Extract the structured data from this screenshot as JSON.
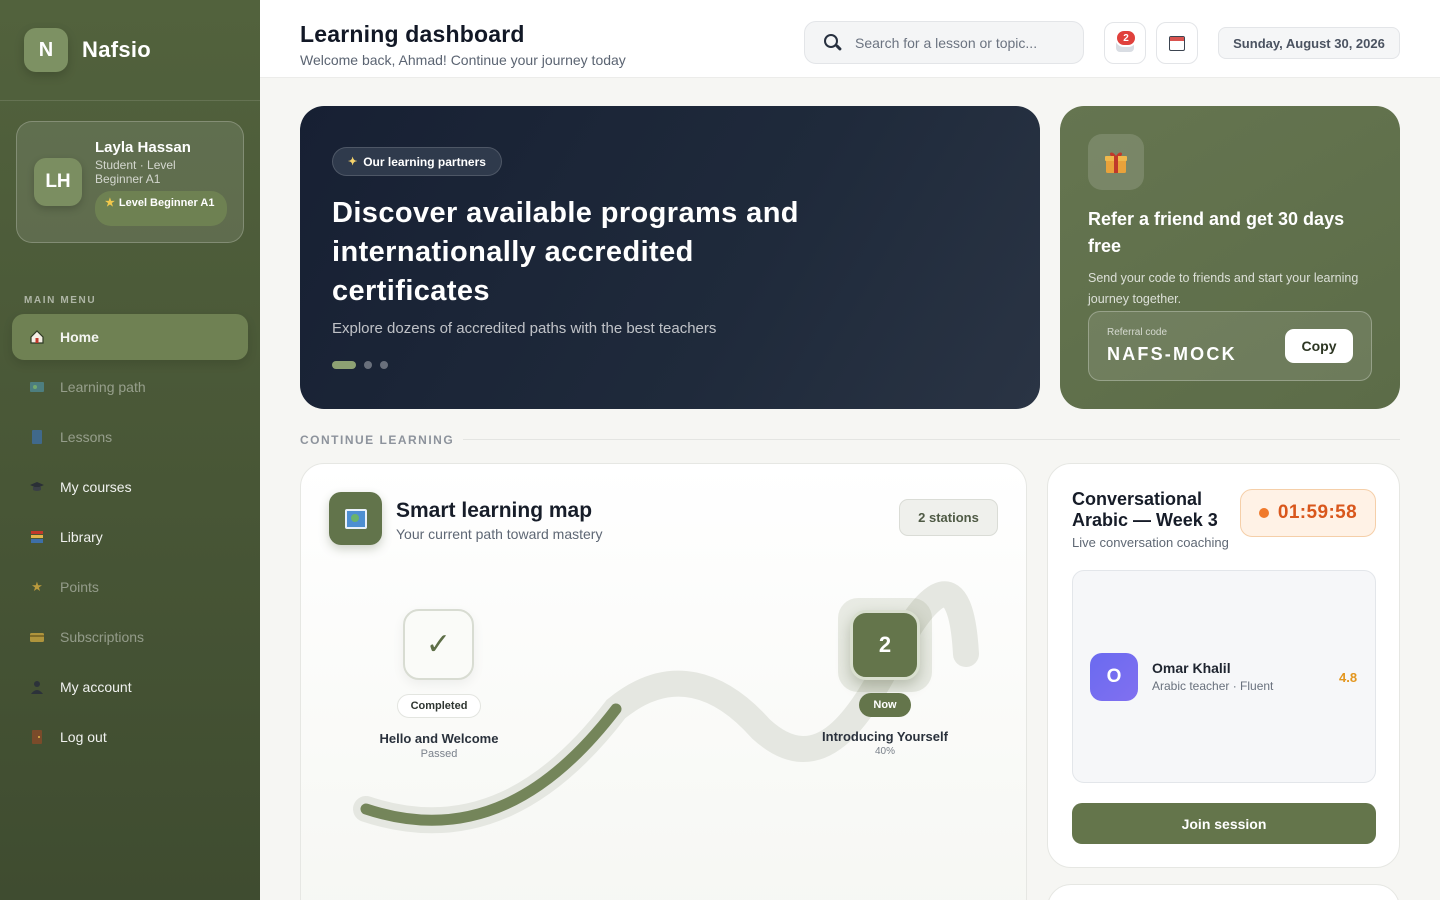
{
  "brand": {
    "logo_letter": "N",
    "name": "Nafsio"
  },
  "profile": {
    "initials": "LH",
    "name": "Layla Hassan",
    "role": "Student · Level Beginner A1",
    "level_badge": "Level Beginner A1"
  },
  "sidebar": {
    "caption": "MAIN MENU",
    "items": [
      {
        "label": "Home",
        "icon": "home-icon",
        "active": true
      },
      {
        "label": "Learning path",
        "icon": "map-icon",
        "active": false
      },
      {
        "label": "Lessons",
        "icon": "book-icon",
        "active": false
      },
      {
        "label": "My courses",
        "icon": "graduation-cap-icon",
        "active": false
      },
      {
        "label": "Library",
        "icon": "books-icon",
        "active": false
      },
      {
        "label": "Points",
        "icon": "star-icon",
        "active": false
      },
      {
        "label": "Subscriptions",
        "icon": "card-icon",
        "active": false
      },
      {
        "label": "My account",
        "icon": "user-icon",
        "active": false
      },
      {
        "label": "Log out",
        "icon": "door-icon",
        "active": false
      }
    ]
  },
  "header": {
    "title": "Learning dashboard",
    "subtitle": "Welcome back, Ahmad! Continue your journey today",
    "search_placeholder": "Search for a lesson or topic...",
    "notification_count": "2",
    "date": "Sunday, August 30, 2026"
  },
  "hero": {
    "pill": "Our learning partners",
    "title": "Discover available programs and internationally accredited certificates",
    "subtitle": "Explore dozens of accredited paths with the best teachers",
    "slides": 3,
    "active_slide": 1
  },
  "referral": {
    "title": "Refer a friend and get 30 days free",
    "text": "Send your code to friends and start your learning journey together.",
    "code_label": "Referral code",
    "code": "NAFS-MOCK",
    "copy_label": "Copy"
  },
  "continue": {
    "caption": "CONTINUE LEARNING"
  },
  "learning_map": {
    "title": "Smart learning map",
    "subtitle": "Your current path toward mastery",
    "stations_badge": "2 stations",
    "stations": [
      {
        "marker": "✓",
        "status": "Completed",
        "title": "Hello and Welcome",
        "detail": "Passed"
      },
      {
        "marker": "2",
        "status": "Now",
        "title": "Introducing Yourself",
        "detail": "40%"
      }
    ]
  },
  "session": {
    "title": "Conversational Arabic — Week 3",
    "subtitle": "Live conversation coaching",
    "countdown": "01:59:58",
    "teacher": {
      "initial": "O",
      "name": "Omar Khalil",
      "role": "Arabic teacher · Fluent",
      "rating": "4.8"
    },
    "join_label": "Join session"
  },
  "colors": {
    "sidebar": "#4d5c3a",
    "accent": "#64754b",
    "hero_bg": "#1b2536",
    "timer_text": "#d9571c",
    "badge_red": "#e0413c"
  }
}
